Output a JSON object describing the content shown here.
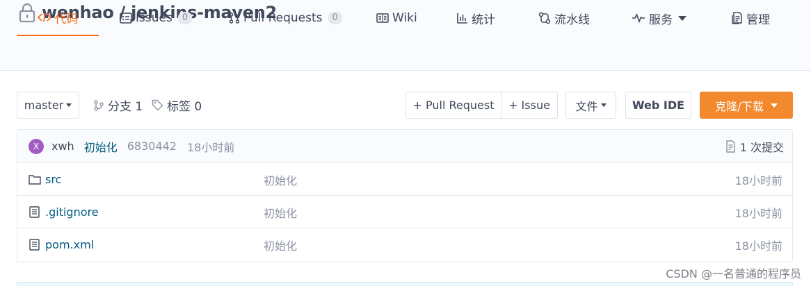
{
  "repo": {
    "owner": "wenhao",
    "name": "jenkins-maven2",
    "title": "wenhao / jenkins-maven2"
  },
  "tabs": [
    {
      "label": "代码",
      "icon": "code-icon",
      "active": true
    },
    {
      "label": "Issues",
      "icon": "issues-icon",
      "badge": "0"
    },
    {
      "label": "Pull Requests",
      "icon": "pull-request-icon",
      "badge": "0"
    },
    {
      "label": "Wiki",
      "icon": "wiki-icon"
    },
    {
      "label": "统计",
      "icon": "stats-icon"
    },
    {
      "label": "流水线",
      "icon": "pipeline-icon"
    },
    {
      "label": "服务",
      "icon": "service-icon"
    },
    {
      "label": "管理",
      "icon": "manage-icon"
    }
  ],
  "toolbar": {
    "branch": "master",
    "branches_label": "分支 1",
    "tags_label": "标签 0",
    "pull_request_label": "+ Pull Request",
    "issue_label": "+ Issue",
    "files_label": "文件",
    "web_ide_label": "Web IDE",
    "clone_label": "克隆/下载"
  },
  "commit": {
    "avatar_letter": "X",
    "author": "xwh",
    "message": "初始化",
    "hash": "6830442",
    "time": "18小时前",
    "count_label": "1 次提交"
  },
  "files": [
    {
      "name": "src",
      "type": "folder",
      "message": "初始化",
      "time": "18小时前"
    },
    {
      "name": ".gitignore",
      "type": "file",
      "message": "初始化",
      "time": "18小时前"
    },
    {
      "name": "pom.xml",
      "type": "file",
      "message": "初始化",
      "time": "18小时前"
    }
  ],
  "watermark": "CSDN @一名普通的程序员",
  "colors": {
    "accent": "#f36c21",
    "link": "#005980",
    "muted": "#8c92a4",
    "avatar": "#a25dc3"
  }
}
